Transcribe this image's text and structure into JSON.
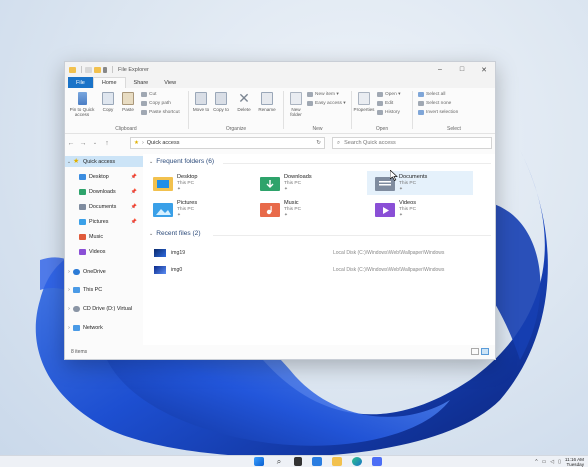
{
  "window": {
    "title": "File Explorer"
  },
  "menu_tabs": [
    "File",
    "Home",
    "Share",
    "View"
  ],
  "ribbon": {
    "clipboard": {
      "pin_label": "Pin to Quick access",
      "copy_label": "Copy",
      "paste_label": "Paste",
      "cut_label": "Cut",
      "copy_path_label": "Copy path",
      "paste_shortcut_label": "Paste shortcut",
      "group_label": "Clipboard"
    },
    "organize": {
      "move_to_label": "Move to",
      "copy_to_label": "Copy to",
      "delete_label": "Delete",
      "rename_label": "Rename",
      "group_label": "Organize"
    },
    "new": {
      "new_folder_label": "New folder",
      "new_item_label": "New item ▾",
      "easy_access_label": "Easy access ▾",
      "group_label": "New"
    },
    "open": {
      "properties_label": "Properties",
      "open_label": "Open ▾",
      "edit_label": "Edit",
      "history_label": "History",
      "group_label": "Open"
    },
    "select": {
      "select_all_label": "Select all",
      "select_none_label": "Select none",
      "invert_selection_label": "Invert selection",
      "group_label": "Select"
    }
  },
  "address": {
    "path": "Quick access",
    "search_placeholder": "Search Quick access"
  },
  "nav_pane": {
    "quick_access": "Quick access",
    "items": [
      "Desktop",
      "Downloads",
      "Documents",
      "Pictures",
      "Music",
      "Videos"
    ],
    "onedrive": "OneDrive",
    "this_pc": "This PC",
    "cd_drive": "CD Drive (D:) Virtual",
    "network": "Network"
  },
  "content": {
    "frequent_title": "Frequent folders (6)",
    "folders": [
      {
        "name": "Desktop",
        "sub": "This PC"
      },
      {
        "name": "Downloads",
        "sub": "This PC"
      },
      {
        "name": "Documents",
        "sub": "This PC"
      },
      {
        "name": "Pictures",
        "sub": "This PC"
      },
      {
        "name": "Music",
        "sub": "This PC"
      },
      {
        "name": "Videos",
        "sub": "This PC"
      }
    ],
    "recent_title": "Recent files (2)",
    "recent": [
      {
        "name": "img19",
        "path": "Local Disk (C:)\\Windows\\Web\\Wallpaper\\Windows"
      },
      {
        "name": "img0",
        "path": "Local Disk (C:)\\Windows\\Web\\Wallpaper\\Windows"
      }
    ]
  },
  "status": {
    "items": "8 items"
  },
  "taskbar": {
    "time": "11:16 AM",
    "day": "Tuesday"
  },
  "colors": {
    "accent": "#1a73c8",
    "selection": "#cce4f7",
    "wallpaper_blue": "#1f4fd0"
  }
}
